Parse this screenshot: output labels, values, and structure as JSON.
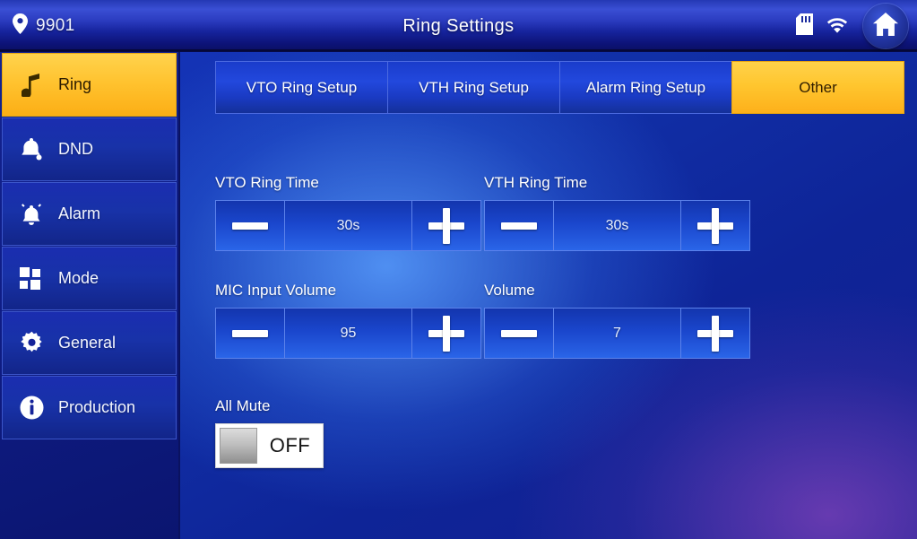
{
  "titlebar": {
    "room_number": "9901",
    "title": "Ring Settings",
    "location_icon": "location-pin-icon",
    "sd_icon": "sd-card-icon",
    "wifi_icon": "wifi-icon",
    "home_icon": "home-icon"
  },
  "sidebar": {
    "items": [
      {
        "label": "Ring",
        "icon": "music-note-icon",
        "active": true
      },
      {
        "label": "DND",
        "icon": "bell-icon",
        "active": false
      },
      {
        "label": "Alarm",
        "icon": "alarm-bell-icon",
        "active": false
      },
      {
        "label": "Mode",
        "icon": "grid-icon",
        "active": false
      },
      {
        "label": "General",
        "icon": "gear-icon",
        "active": false
      },
      {
        "label": "Production",
        "icon": "info-icon",
        "active": false
      }
    ]
  },
  "tabs": [
    {
      "label": "VTO Ring Setup",
      "active": false
    },
    {
      "label": "VTH Ring Setup",
      "active": false
    },
    {
      "label": "Alarm Ring Setup",
      "active": false
    },
    {
      "label": "Other",
      "active": true
    }
  ],
  "fields": [
    {
      "label": "VTO Ring Time",
      "value": "30s",
      "minus": "minus-icon",
      "plus": "plus-icon"
    },
    {
      "label": "VTH Ring Time",
      "value": "30s",
      "minus": "minus-icon",
      "plus": "plus-icon"
    },
    {
      "label": "MIC Input Volume",
      "value": "95",
      "minus": "minus-icon",
      "plus": "plus-icon"
    },
    {
      "label": "Volume",
      "value": "7",
      "minus": "minus-icon",
      "plus": "plus-icon"
    }
  ],
  "all_mute": {
    "label": "All Mute",
    "state": "OFF"
  },
  "colors": {
    "accent_yellow": "#ffc62f",
    "panel_blue": "#1a46cc",
    "titlebar_blue": "#16239c",
    "sidebar_blue": "#13238f",
    "text_white": "#ffffff",
    "toggle_white": "#ffffff"
  }
}
